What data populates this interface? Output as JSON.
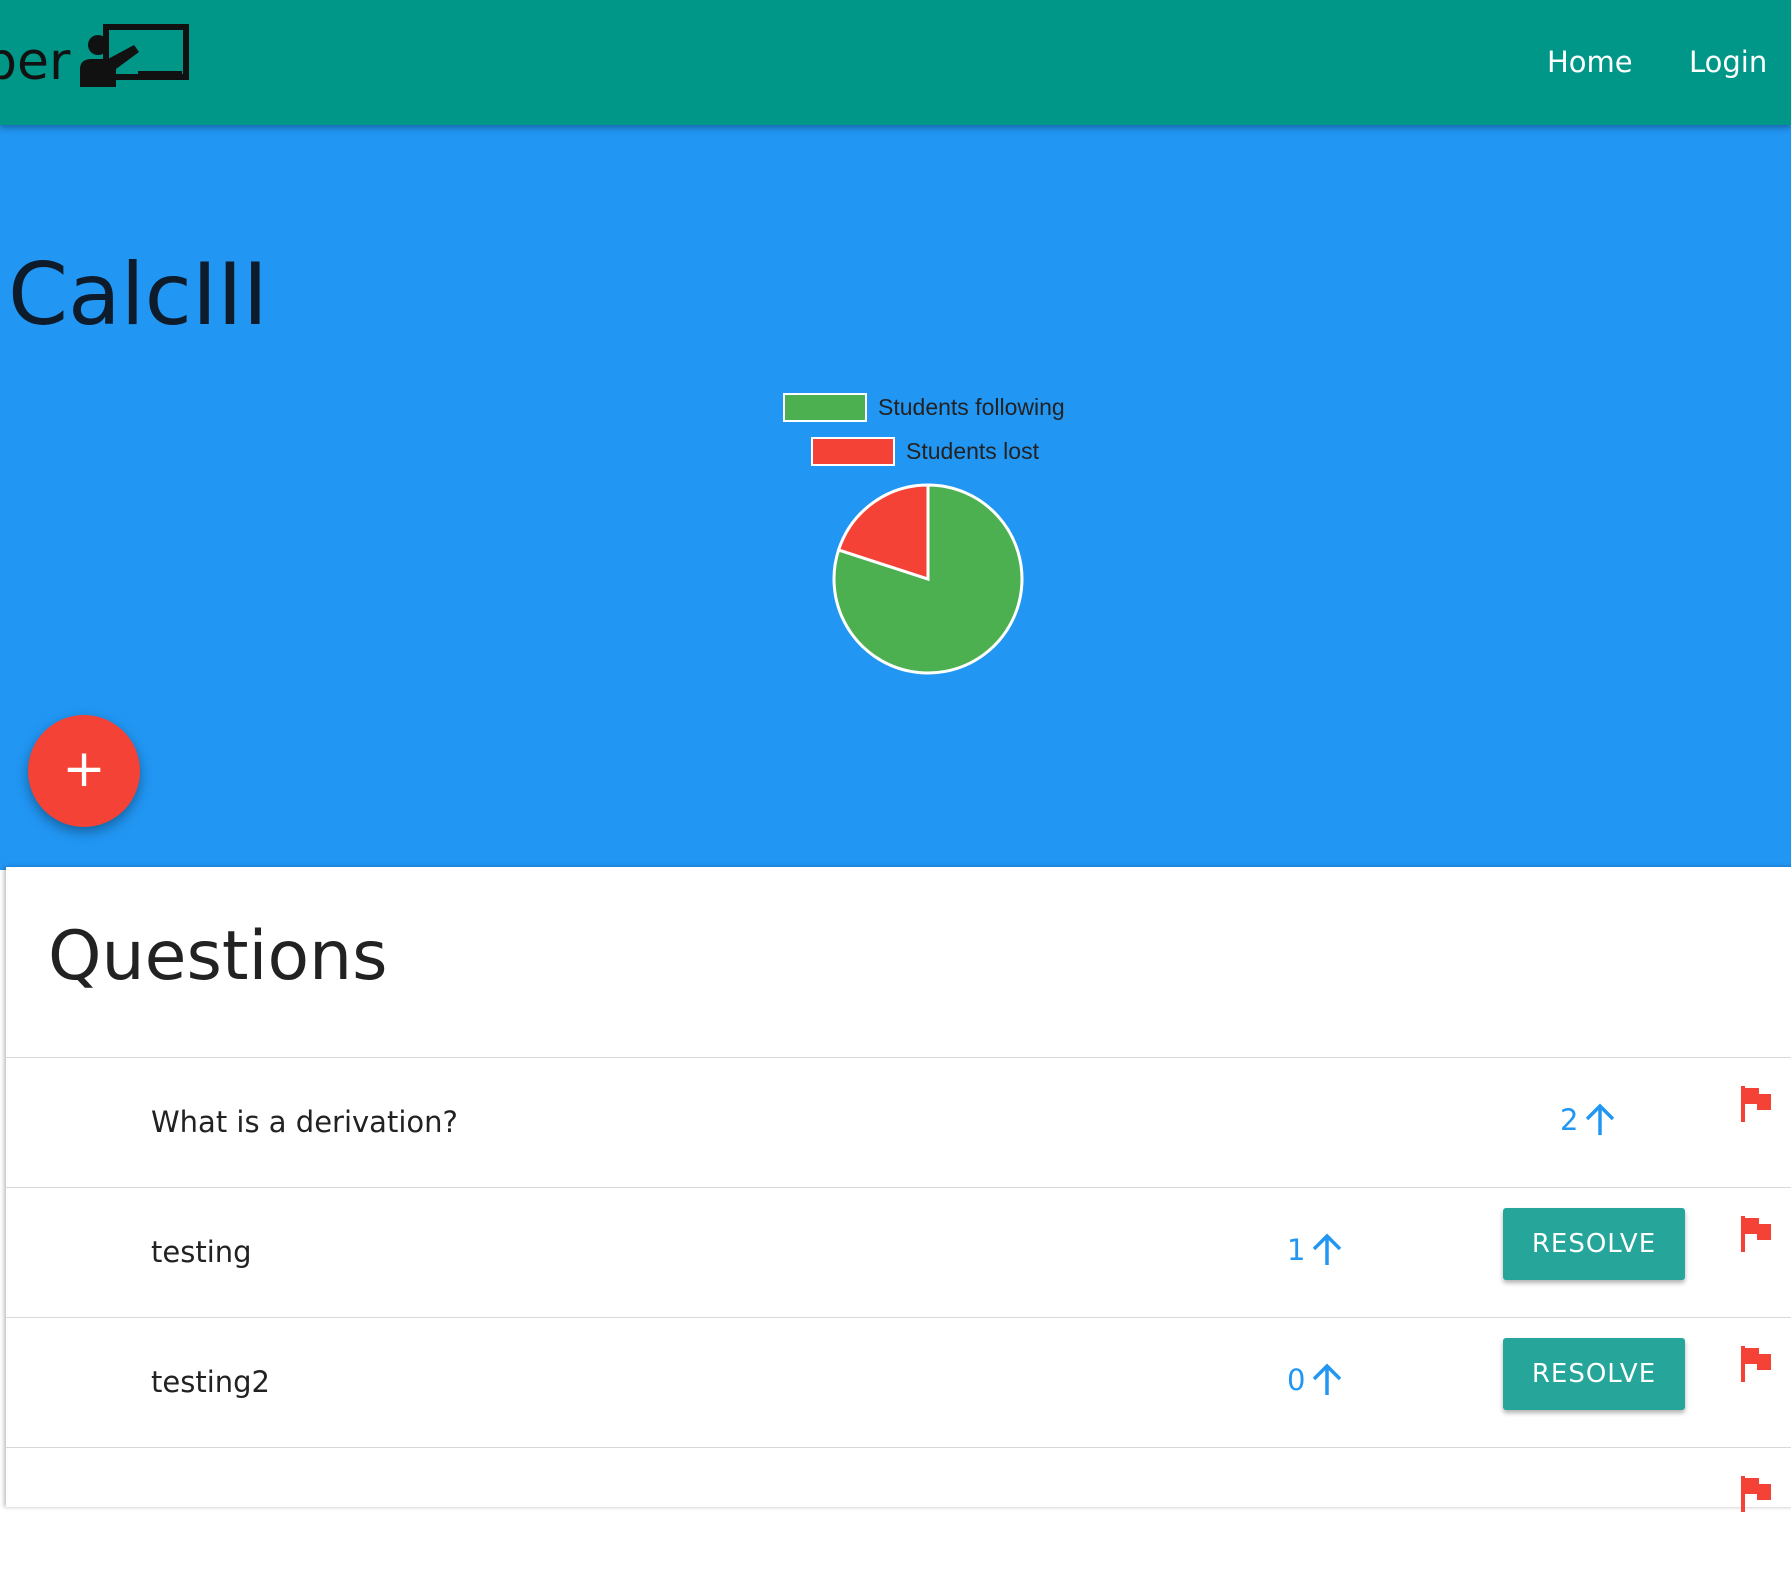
{
  "nav": {
    "brand_fragment": "ber",
    "links": [
      {
        "label": "Home"
      },
      {
        "label": "Login"
      }
    ]
  },
  "course": {
    "title": "CalcIII"
  },
  "chart_data": {
    "type": "pie",
    "categories": [
      "Students following",
      "Students lost"
    ],
    "values": [
      80,
      20
    ],
    "colors": [
      "#4caf50",
      "#f44336"
    ],
    "legend_position": "top"
  },
  "fab": {
    "label": "+",
    "icon": "add-icon",
    "color": "#f44336"
  },
  "questions": {
    "heading": "Questions",
    "items": [
      {
        "text": "What is a derivation?",
        "votes": "2",
        "has_resolve": false
      },
      {
        "text": "testing",
        "votes": "1",
        "has_resolve": true
      },
      {
        "text": "testing2",
        "votes": "0",
        "has_resolve": true
      },
      {
        "text": "",
        "votes": "",
        "has_resolve": false
      }
    ],
    "resolve_label": "RESOLVE",
    "flag_icon": "flag-icon",
    "upvote_icon": "arrow-up-icon"
  },
  "colors": {
    "navbar": "#009688",
    "hero": "#2196f3",
    "accent": "#26a69a",
    "flag": "#f44336",
    "vote": "#2196f3"
  }
}
